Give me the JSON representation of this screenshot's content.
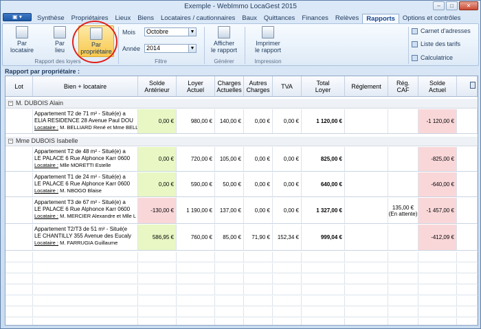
{
  "window": {
    "title": "Exemple - WebImmo LocaGest 2015",
    "app_button": "▣ ▾"
  },
  "tabs": [
    "Synthèse",
    "Propriétaires",
    "Lieux",
    "Biens",
    "Locataires / cautionnaires",
    "Baux",
    "Quittances",
    "Finances",
    "Relèves",
    "Rapports",
    "Options et contrôles"
  ],
  "active_tab": "Rapports",
  "ribbon": {
    "par_locataire": "Par\nlocataire",
    "par_lieu": "Par\nlieu",
    "par_proprietaire": "Par\npropriétaire",
    "group_rapport": "Rapport des loyers",
    "mois_label": "Mois",
    "mois_value": "Octobre",
    "annee_label": "Année",
    "annee_value": "2014",
    "group_filtre": "Filtre",
    "afficher": "Afficher\nle rapport",
    "group_generer": "Générer",
    "imprimer": "Imprimer\nle rapport",
    "group_impression": "Impression",
    "carnet": "Carnet d'adresses",
    "tarifs": "Liste des tarifs",
    "calc": "Calculatrice"
  },
  "report_title": "Rapport par propriétaire :",
  "columns": {
    "lot": "Lot",
    "bien": "Bien + locataire",
    "solde_ant": "Solde\nAntérieur",
    "loyer": "Loyer\nActuel",
    "charges": "Charges\nActuelles",
    "autres": "Autres\nCharges",
    "tva": "TVA",
    "total": "Total\nLoyer",
    "reglement": "Réglement",
    "caf": "Rég.\nCAF",
    "solde": "Solde\nActuel"
  },
  "groups": [
    {
      "name": "M. DUBOIS Alain",
      "rows": [
        {
          "l1": "Appartement T2 de 71 m² - Situé(e) a",
          "l2": "ELIA RESIDENCE 28 Avenue Paul DOU",
          "loc": "M. BELLIARD René et Mme BELLI",
          "solde_ant": "0,00 €",
          "loyer": "980,00 €",
          "charges": "140,00 €",
          "autres": "0,00 €",
          "tva": "0,00 €",
          "total": "1 120,00 €",
          "caf": "",
          "caf2": "",
          "solde": "-1 120,00 €",
          "ant_color": "green"
        }
      ]
    },
    {
      "name": "Mme DUBOIS Isabelle",
      "rows": [
        {
          "l1": "Appartement T2 de 48 m² - Situé(e) a",
          "l2": "LE PALACE 6 Rue Alphonce Karr 0600",
          "loc": "Mlle MORETTI Estelle",
          "solde_ant": "0,00 €",
          "loyer": "720,00 €",
          "charges": "105,00 €",
          "autres": "0,00 €",
          "tva": "0,00 €",
          "total": "825,00 €",
          "caf": "",
          "caf2": "",
          "solde": "-825,00 €",
          "ant_color": "green"
        },
        {
          "l1": "Appartement T1 de 24 m² - Situé(e) a",
          "l2": "LE PALACE 6 Rue Alphonce Karr 0600",
          "loc": "M. NBOGO Blaise",
          "solde_ant": "0,00 €",
          "loyer": "590,00 €",
          "charges": "50,00 €",
          "autres": "0,00 €",
          "tva": "0,00 €",
          "total": "640,00 €",
          "caf": "",
          "caf2": "",
          "solde": "-640,00 €",
          "ant_color": "green"
        },
        {
          "l1": "Appartement T3 de 67 m² - Situé(e) a",
          "l2": "LE PALACE 6 Rue Alphonce Karr 0600",
          "loc": "M. MERCIER Alexandre et Mlle L",
          "solde_ant": "-130,00 €",
          "loyer": "1 190,00 €",
          "charges": "137,00 €",
          "autres": "0,00 €",
          "tva": "0,00 €",
          "total": "1 327,00 €",
          "caf": "135,00 €",
          "caf2": "(En attente)",
          "solde": "-1 457,00 €",
          "ant_color": "pink"
        },
        {
          "l1": "Appartement T2/T3 de 51 m² - Situé(e",
          "l2": "LE CHANTILLY 355 Avenue des Eucaly",
          "loc": "M. FARRUGIA Guillaume",
          "solde_ant": "586,95 €",
          "loyer": "760,00 €",
          "charges": "85,00 €",
          "autres": "71,90 €",
          "tva": "152,34 €",
          "total": "999,04 €",
          "caf": "",
          "caf2": "",
          "solde": "-412,09 €",
          "ant_color": "green"
        }
      ]
    }
  ],
  "locataire_label": "Locataire :"
}
